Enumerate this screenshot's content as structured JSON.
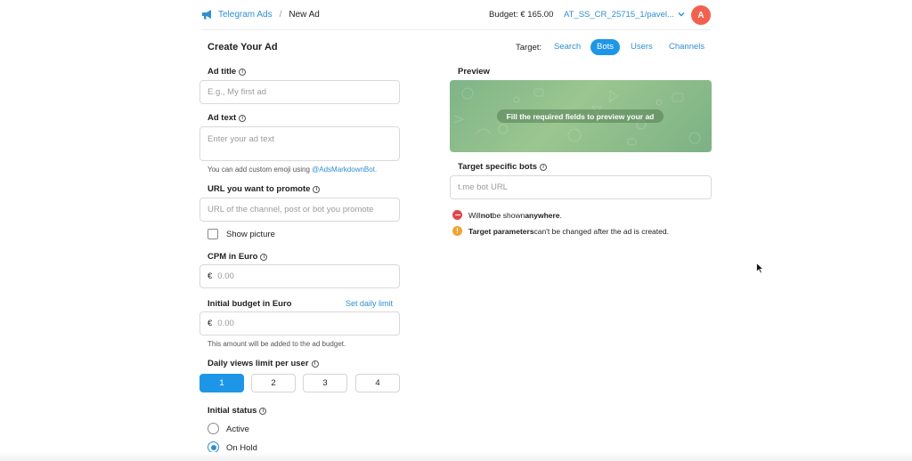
{
  "header": {
    "app_name": "Telegram Ads",
    "separator": "/",
    "page_name": "New Ad",
    "budget": "Budget: € 165.00",
    "account": "AT_SS_CR_25715_1/pavel...",
    "avatar_letter": "A",
    "accent_color": "#2f8fd0"
  },
  "form": {
    "title": "Create Your Ad",
    "ad_title": {
      "label": "Ad title",
      "placeholder": "E.g., My first ad"
    },
    "ad_text": {
      "label": "Ad text",
      "placeholder": "Enter your ad text",
      "hint_prefix": "You can add custom emoji using",
      "hint_link": "@AdsMarkdownBot."
    },
    "url": {
      "label": "URL you want to promote",
      "placeholder": "URL of the channel, post or bot you promote"
    },
    "show_picture": {
      "label": "Show picture",
      "checked": false
    },
    "cpm": {
      "label": "CPM in Euro",
      "currency": "€",
      "placeholder": "0.00"
    },
    "budget": {
      "label": "Initial budget in Euro",
      "set_daily_limit": "Set daily limit",
      "currency": "€",
      "placeholder": "0.00",
      "hint": "This amount will be added to the ad budget."
    },
    "daily_views": {
      "label": "Daily views limit per user",
      "options": [
        "1",
        "2",
        "3",
        "4"
      ],
      "selected": "1"
    },
    "status": {
      "label": "Initial status",
      "options": [
        "Active",
        "On Hold"
      ],
      "selected": "On Hold"
    }
  },
  "target": {
    "label": "Target:",
    "tabs": [
      "Search",
      "Bots",
      "Users",
      "Channels"
    ],
    "active_tab": "Bots"
  },
  "preview": {
    "title": "Preview",
    "message": "Fill the required fields to preview your ad"
  },
  "bots": {
    "label": "Target specific bots",
    "placeholder": "t.me bot URL"
  },
  "notices": [
    {
      "icon": "minus-circle-icon",
      "color": "#e0474c",
      "bold1": "",
      "text": "Will ",
      "bold_a": "not",
      "mid": " be shown ",
      "bold_b": "anywhere",
      "end": "."
    },
    {
      "icon": "exclamation-circle-icon",
      "color": "#f0a232",
      "bold_a": "Target parameters",
      "end": " can't be changed after the ad is created."
    }
  ]
}
